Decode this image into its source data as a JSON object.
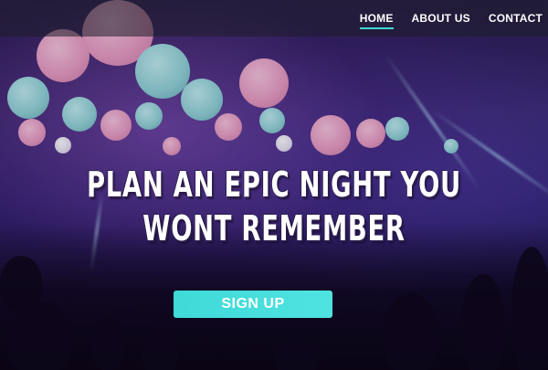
{
  "nav": {
    "items": [
      {
        "label": "HOME",
        "active": true
      },
      {
        "label": "ABOUT US",
        "active": false
      },
      {
        "label": "CONTACT",
        "active": false
      }
    ]
  },
  "hero": {
    "title_line1": "PLAN AN EPIC NIGHT YOU",
    "title_line2": "WONT REMEMBER",
    "cta_label": "SIGN UP"
  },
  "colors": {
    "accent": "#3fdad8",
    "nav_background": "rgba(30,30,40,0.55)"
  }
}
